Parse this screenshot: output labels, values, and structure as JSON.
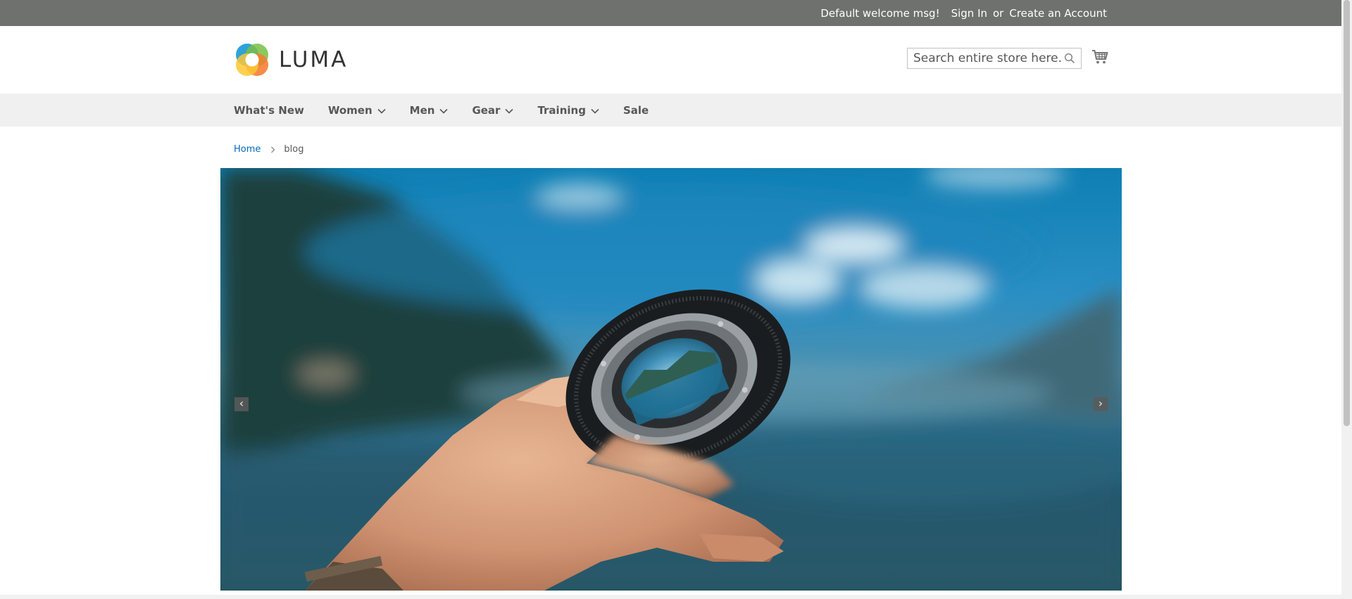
{
  "top_bar": {
    "welcome": "Default welcome msg!",
    "sign_in": "Sign In",
    "or": "or",
    "create_account": "Create an Account"
  },
  "header": {
    "logo_text": "LUMA",
    "search_placeholder": "Search entire store here...",
    "icons": {
      "search": "search-icon",
      "cart": "cart-icon"
    }
  },
  "nav": {
    "items": [
      {
        "label": "What's New",
        "has_submenu": false
      },
      {
        "label": "Women",
        "has_submenu": true
      },
      {
        "label": "Men",
        "has_submenu": true
      },
      {
        "label": "Gear",
        "has_submenu": true
      },
      {
        "label": "Training",
        "has_submenu": true
      },
      {
        "label": "Sale",
        "has_submenu": false
      }
    ]
  },
  "breadcrumbs": {
    "home": "Home",
    "current": "blog"
  },
  "slider": {
    "prev_label": "‹",
    "next_label": "›"
  },
  "colors": {
    "top_bar_bg": "#6e716e",
    "nav_bg": "#f0f0f0",
    "link": "#006bb4"
  }
}
